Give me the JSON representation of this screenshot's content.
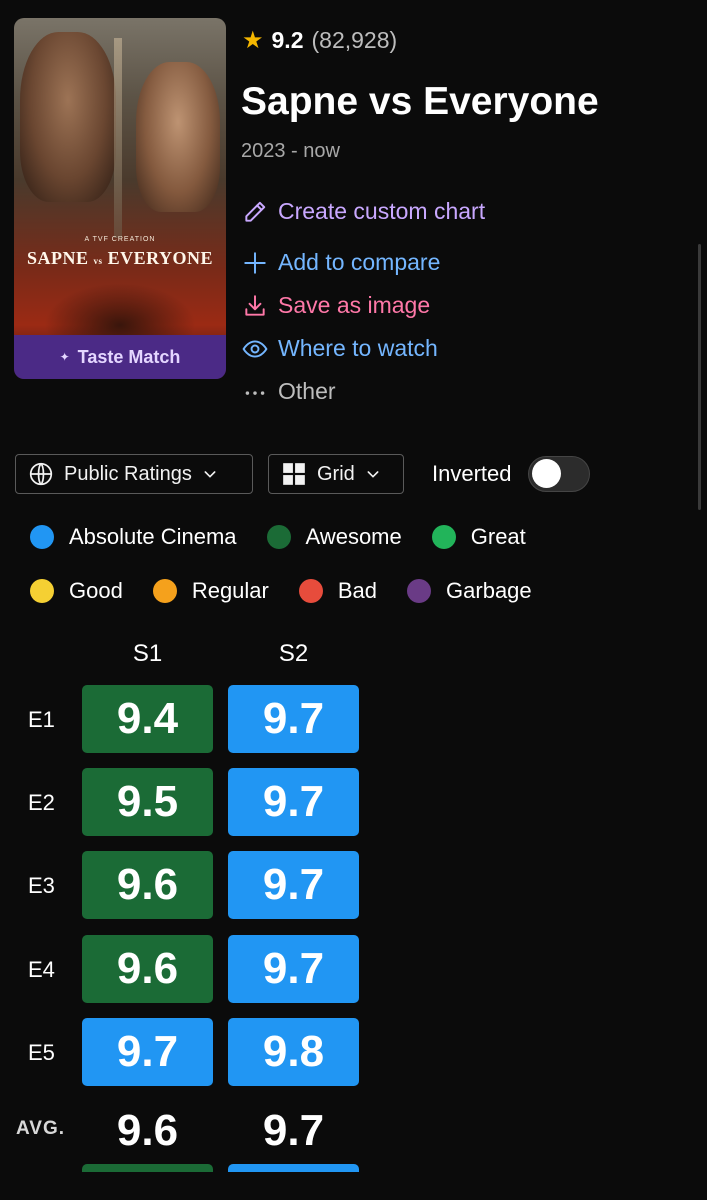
{
  "poster": {
    "creation_text": "A TVF CREATION",
    "title_left": "SAPNE",
    "title_vs": "vs",
    "title_right": "EVERYONE",
    "taste_match": "Taste Match"
  },
  "show": {
    "rating": "9.2",
    "rating_count": "(82,928)",
    "title": "Sapne vs Everyone",
    "years": "2023 - now"
  },
  "actions": {
    "create_chart": "Create custom chart",
    "add_compare": "Add to compare",
    "save_image": "Save as image",
    "where_watch": "Where to watch",
    "other": "Other"
  },
  "controls": {
    "ratings_select": "Public Ratings",
    "view_select": "Grid",
    "inverted_label": "Inverted",
    "inverted_on": false
  },
  "legend": [
    {
      "label": "Absolute Cinema",
      "color": "#2196f3"
    },
    {
      "label": "Awesome",
      "color": "#1b6b36"
    },
    {
      "label": "Great",
      "color": "#22b45a"
    },
    {
      "label": "Good",
      "color": "#f5d033"
    },
    {
      "label": "Regular",
      "color": "#f5a11c"
    },
    {
      "label": "Bad",
      "color": "#e74c3c"
    },
    {
      "label": "Garbage",
      "color": "#6a3b86"
    }
  ],
  "grid": {
    "seasons": [
      "S1",
      "S2"
    ],
    "episodes": [
      "E1",
      "E2",
      "E3",
      "E4",
      "E5"
    ],
    "ratings": [
      [
        "9.4",
        "9.7"
      ],
      [
        "9.5",
        "9.7"
      ],
      [
        "9.6",
        "9.7"
      ],
      [
        "9.6",
        "9.7"
      ],
      [
        "9.7",
        "9.8"
      ]
    ],
    "categories": [
      [
        "Awesome",
        "Absolute Cinema"
      ],
      [
        "Awesome",
        "Absolute Cinema"
      ],
      [
        "Awesome",
        "Absolute Cinema"
      ],
      [
        "Awesome",
        "Absolute Cinema"
      ],
      [
        "Absolute Cinema",
        "Absolute Cinema"
      ]
    ],
    "avg_label": "AVG.",
    "averages": [
      "9.6",
      "9.7"
    ],
    "avg_categories": [
      "Awesome",
      "Absolute Cinema"
    ]
  }
}
